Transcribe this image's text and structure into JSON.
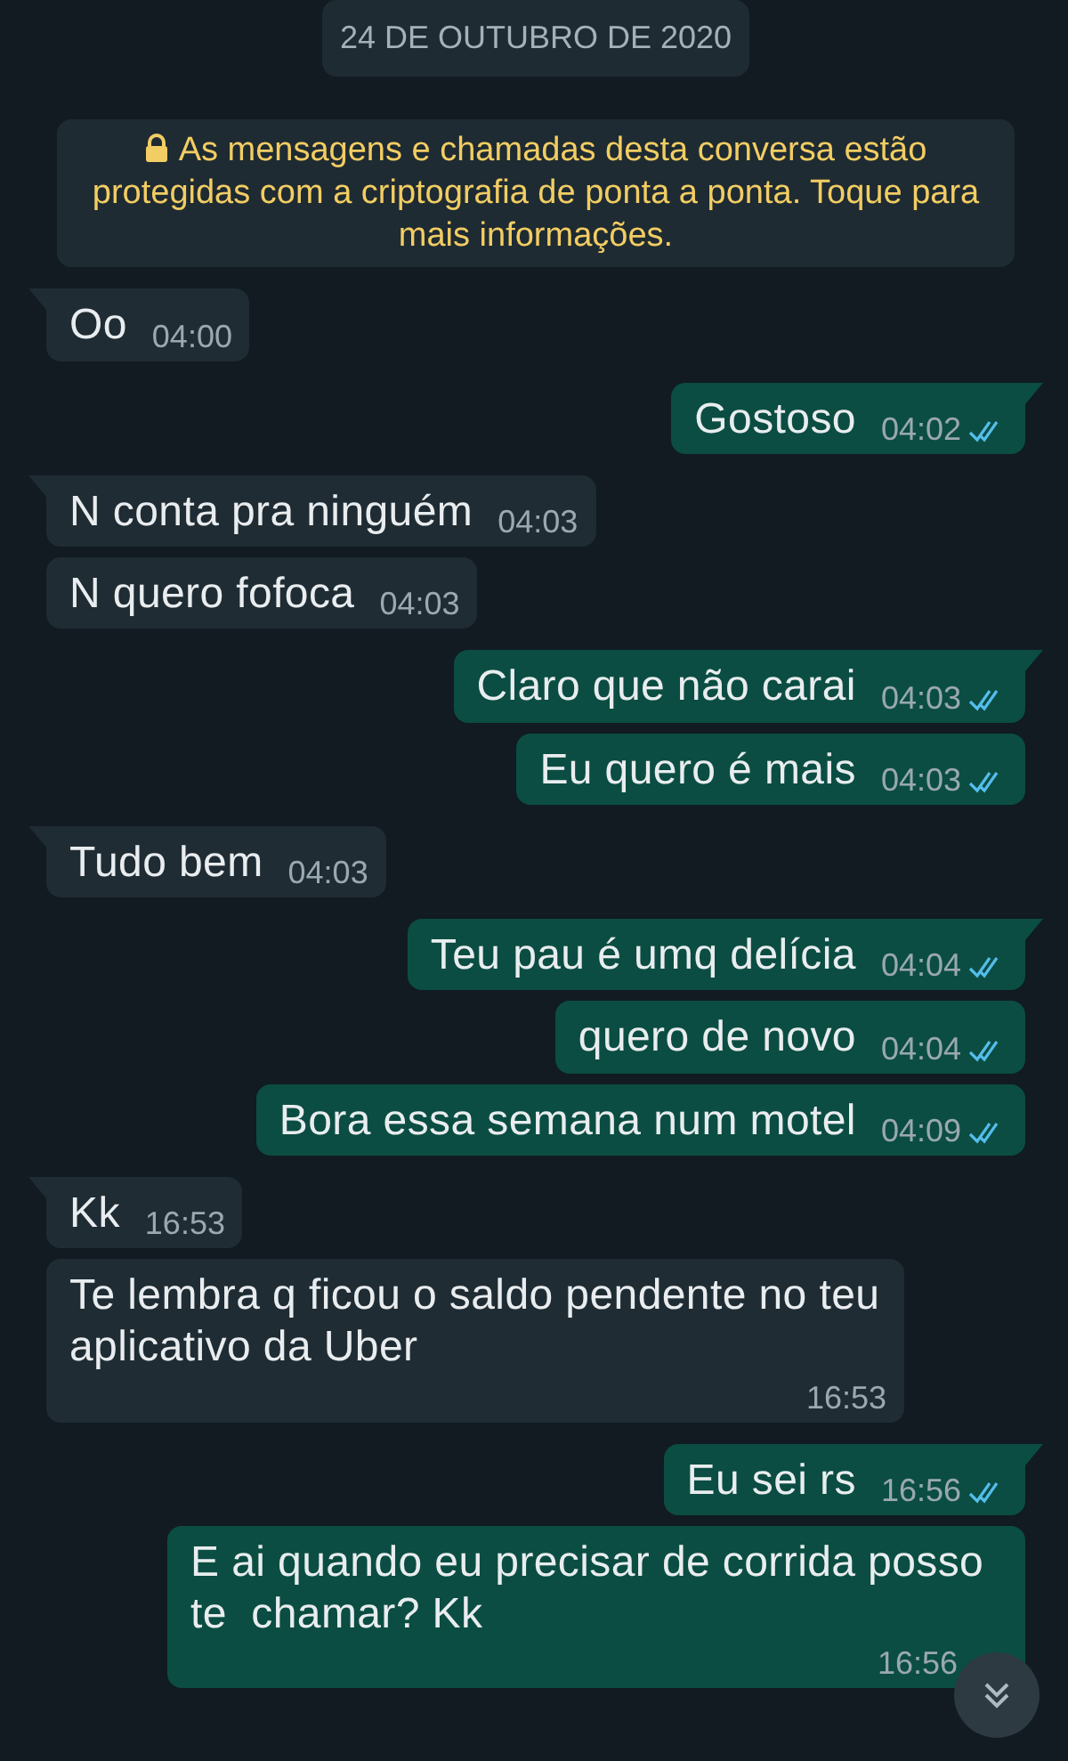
{
  "date_chip": "24 DE OUTUBRO DE 2020",
  "encryption_notice": "As mensagens e chamadas desta conversa estão protegidas com a criptografia de ponta a ponta. Toque para mais informações.",
  "messages": [
    {
      "kind": "in",
      "tail": true,
      "text": "Oo",
      "time": "04:00"
    },
    {
      "kind": "out",
      "tail": true,
      "text": "Gostoso",
      "time": "04:02",
      "read": true
    },
    {
      "kind": "in",
      "tail": true,
      "text": "N conta pra ninguém",
      "time": "04:03"
    },
    {
      "kind": "in",
      "tail": false,
      "text": "N quero fofoca",
      "time": "04:03"
    },
    {
      "kind": "out",
      "tail": true,
      "text": "Claro que não carai",
      "time": "04:03",
      "read": true
    },
    {
      "kind": "out",
      "tail": false,
      "text": "Eu quero é mais",
      "time": "04:03",
      "read": true
    },
    {
      "kind": "in",
      "tail": true,
      "text": "Tudo bem",
      "time": "04:03"
    },
    {
      "kind": "out",
      "tail": true,
      "text": "Teu pau é umq delícia",
      "time": "04:04",
      "read": true
    },
    {
      "kind": "out",
      "tail": false,
      "text": "quero de novo",
      "time": "04:04",
      "read": true
    },
    {
      "kind": "out",
      "tail": false,
      "text": "Bora essa semana num motel",
      "time": "04:09",
      "read": true
    },
    {
      "kind": "in",
      "tail": true,
      "text": "Kk",
      "time": "16:53"
    },
    {
      "kind": "in",
      "tail": false,
      "text": "Te lembra q ficou o saldo pendente no teu aplicativo da Uber",
      "time": "16:53"
    },
    {
      "kind": "out",
      "tail": true,
      "text": "Eu sei rs",
      "time": "16:56",
      "read": true
    },
    {
      "kind": "out",
      "tail": false,
      "text": "E ai quando eu precisar de corrida posso te  chamar? Kk",
      "time": "16:56"
    }
  ]
}
